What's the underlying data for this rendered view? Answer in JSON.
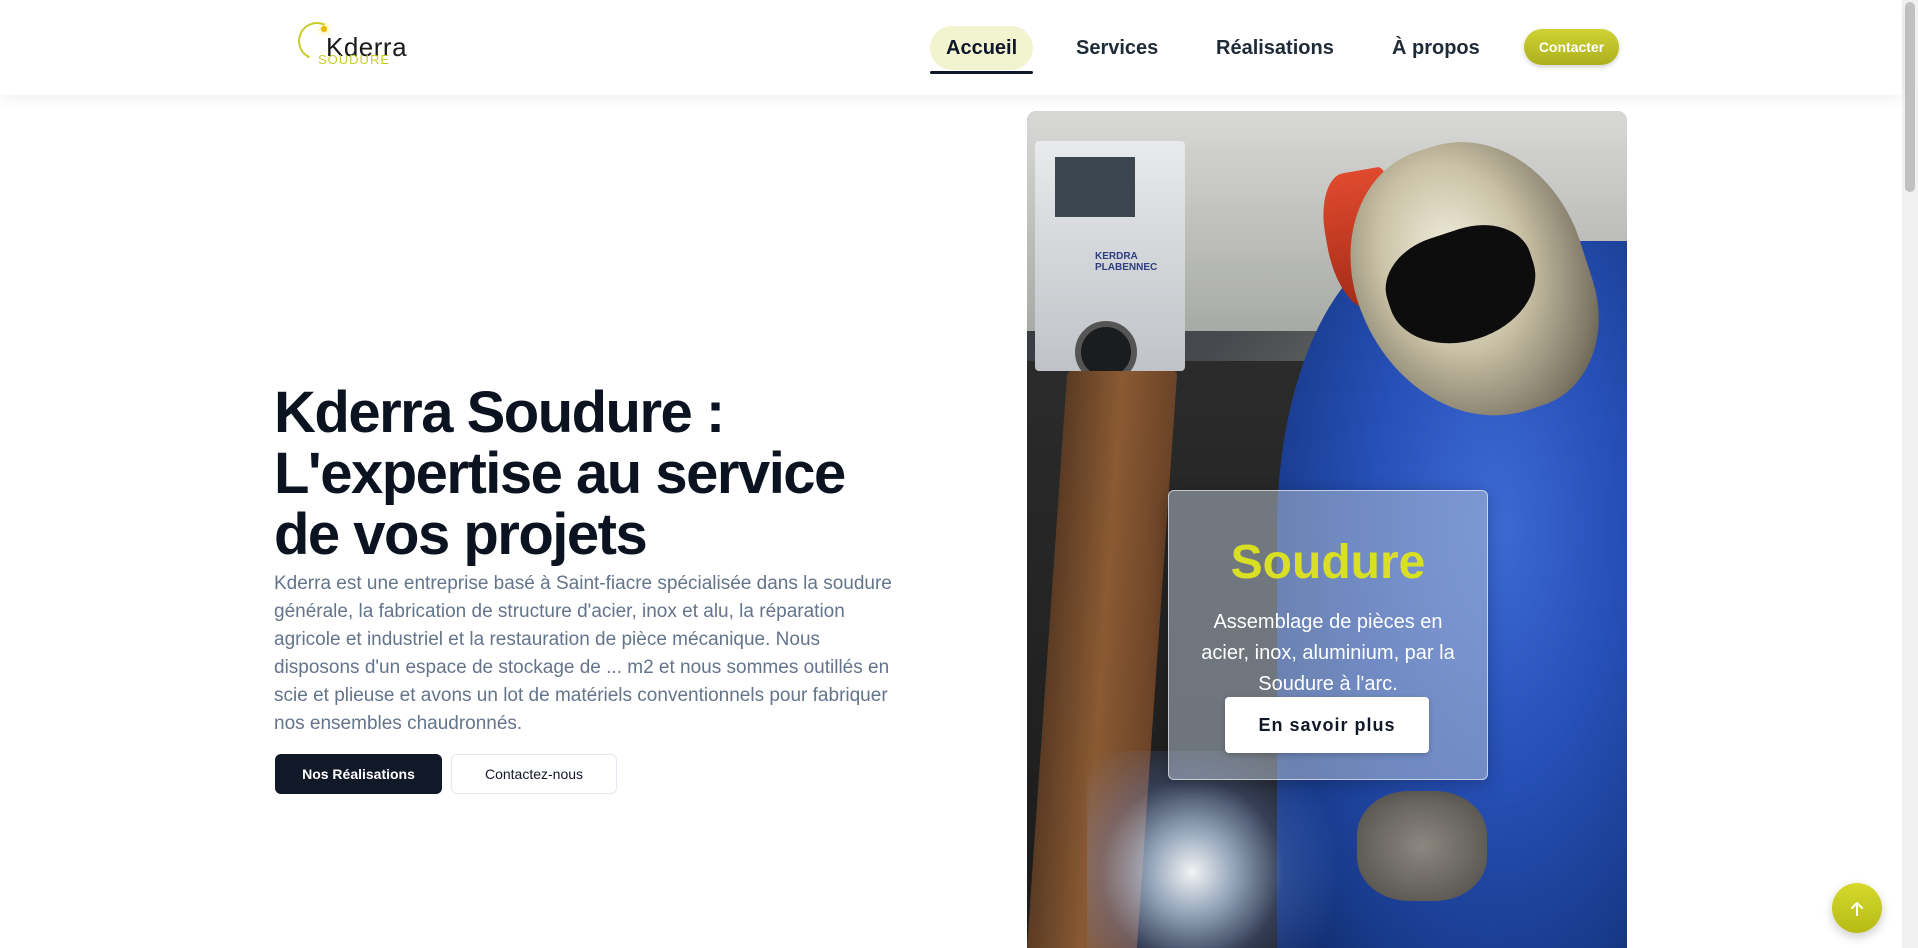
{
  "header": {
    "logo": {
      "brand": "Kderra",
      "tagline": "SOUDURE"
    },
    "nav": [
      {
        "label": "Accueil",
        "active": true
      },
      {
        "label": "Services",
        "active": false
      },
      {
        "label": "Réalisations",
        "active": false
      },
      {
        "label": "À propos",
        "active": false
      }
    ],
    "contact_label": "Contacter"
  },
  "hero": {
    "title": "Kderra Soudure : L'expertise au service de vos projets",
    "description": "Kderra est une entreprise basé à Saint-fiacre spécialisée dans la soudure générale, la fabrication de structure d'acier, inox et alu, la réparation agricole et industriel et la restauration de pièce mécanique. Nous disposons d'un espace de stockage de ... m2 et nous sommes outillés en scie et plieuse et avons un lot de matériels conventionnels pour fabriquer nos ensembles chaudronnés.",
    "primary_button": "Nos Réalisations",
    "secondary_button": "Contactez-nous"
  },
  "feature_card": {
    "title": "Soudure",
    "description": "Assemblage de pièces en acier, inox, aluminium, par la Soudure à l'arc.",
    "button": "En savoir plus"
  },
  "image": {
    "truck_text": "KERDRA PLABENNEC"
  },
  "back_to_top_icon": "arrow-up-icon",
  "colors": {
    "accent": "#c9cc2a",
    "dark": "#111827",
    "active_nav_bg": "#f1f4cf"
  }
}
